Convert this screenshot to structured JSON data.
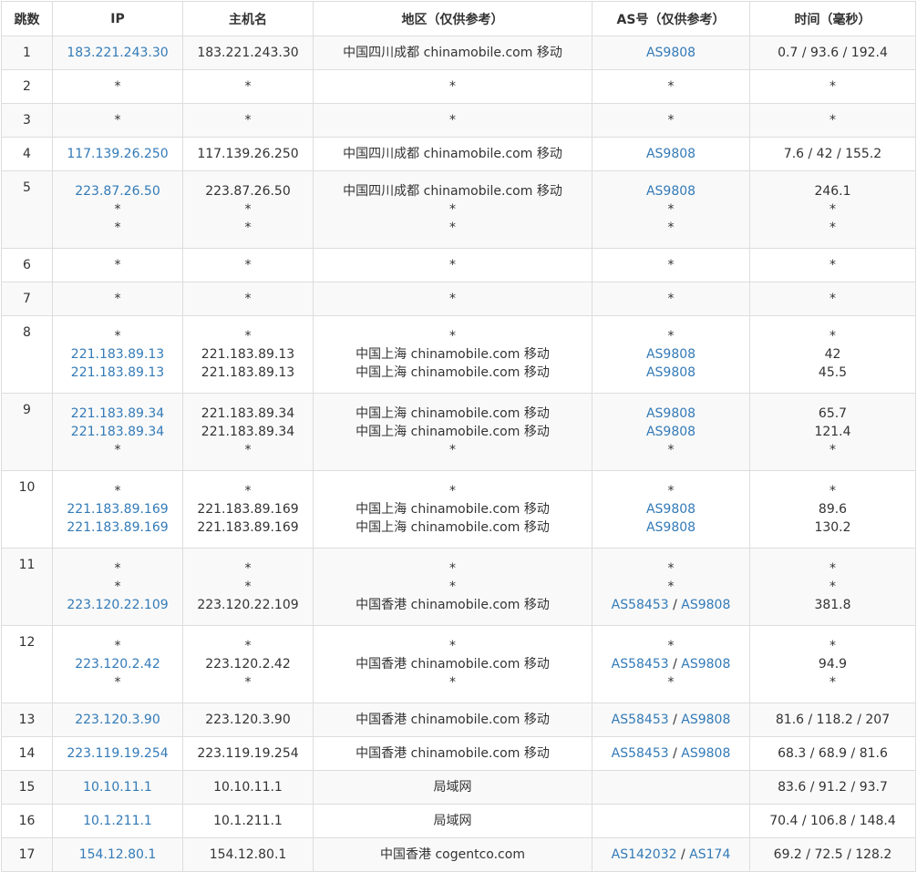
{
  "table": {
    "headers": [
      "跳数",
      "IP",
      "主机名",
      "地区（仅供参考）",
      "AS号（仅供参考）",
      "时间（毫秒）"
    ],
    "rows": [
      {
        "hop": "1",
        "lines": [
          {
            "ip": "183.221.243.30",
            "host": "183.221.243.30",
            "region": "中国四川成都 chinamobile.com 移动",
            "as": [
              "AS9808"
            ],
            "time": "0.7 / 93.6 / 192.4"
          }
        ]
      },
      {
        "hop": "2",
        "lines": [
          {
            "ip": "*",
            "host": "*",
            "region": "*",
            "as": [
              "*"
            ],
            "time": "*"
          }
        ]
      },
      {
        "hop": "3",
        "lines": [
          {
            "ip": "*",
            "host": "*",
            "region": "*",
            "as": [
              "*"
            ],
            "time": "*"
          }
        ]
      },
      {
        "hop": "4",
        "lines": [
          {
            "ip": "117.139.26.250",
            "host": "117.139.26.250",
            "region": "中国四川成都 chinamobile.com 移动",
            "as": [
              "AS9808"
            ],
            "time": "7.6 / 42 / 155.2"
          }
        ]
      },
      {
        "hop": "5",
        "lines": [
          {
            "ip": "223.87.26.50",
            "host": "223.87.26.50",
            "region": "中国四川成都 chinamobile.com 移动",
            "as": [
              "AS9808"
            ],
            "time": "246.1"
          },
          {
            "ip": "*",
            "host": "*",
            "region": "*",
            "as": [
              "*"
            ],
            "time": "*"
          },
          {
            "ip": "*",
            "host": "*",
            "region": "*",
            "as": [
              "*"
            ],
            "time": "*"
          }
        ]
      },
      {
        "hop": "6",
        "lines": [
          {
            "ip": "*",
            "host": "*",
            "region": "*",
            "as": [
              "*"
            ],
            "time": "*"
          }
        ]
      },
      {
        "hop": "7",
        "lines": [
          {
            "ip": "*",
            "host": "*",
            "region": "*",
            "as": [
              "*"
            ],
            "time": "*"
          }
        ]
      },
      {
        "hop": "8",
        "lines": [
          {
            "ip": "*",
            "host": "*",
            "region": "*",
            "as": [
              "*"
            ],
            "time": "*"
          },
          {
            "ip": "221.183.89.13",
            "host": "221.183.89.13",
            "region": "中国上海 chinamobile.com 移动",
            "as": [
              "AS9808"
            ],
            "time": "42"
          },
          {
            "ip": "221.183.89.13",
            "host": "221.183.89.13",
            "region": "中国上海 chinamobile.com 移动",
            "as": [
              "AS9808"
            ],
            "time": "45.5"
          }
        ]
      },
      {
        "hop": "9",
        "lines": [
          {
            "ip": "221.183.89.34",
            "host": "221.183.89.34",
            "region": "中国上海 chinamobile.com 移动",
            "as": [
              "AS9808"
            ],
            "time": "65.7"
          },
          {
            "ip": "221.183.89.34",
            "host": "221.183.89.34",
            "region": "中国上海 chinamobile.com 移动",
            "as": [
              "AS9808"
            ],
            "time": "121.4"
          },
          {
            "ip": "*",
            "host": "*",
            "region": "*",
            "as": [
              "*"
            ],
            "time": "*"
          }
        ]
      },
      {
        "hop": "10",
        "lines": [
          {
            "ip": "*",
            "host": "*",
            "region": "*",
            "as": [
              "*"
            ],
            "time": "*"
          },
          {
            "ip": "221.183.89.169",
            "host": "221.183.89.169",
            "region": "中国上海 chinamobile.com 移动",
            "as": [
              "AS9808"
            ],
            "time": "89.6"
          },
          {
            "ip": "221.183.89.169",
            "host": "221.183.89.169",
            "region": "中国上海 chinamobile.com 移动",
            "as": [
              "AS9808"
            ],
            "time": "130.2"
          }
        ]
      },
      {
        "hop": "11",
        "lines": [
          {
            "ip": "*",
            "host": "*",
            "region": "*",
            "as": [
              "*"
            ],
            "time": "*"
          },
          {
            "ip": "*",
            "host": "*",
            "region": "*",
            "as": [
              "*"
            ],
            "time": "*"
          },
          {
            "ip": "223.120.22.109",
            "host": "223.120.22.109",
            "region": "中国香港 chinamobile.com 移动",
            "as": [
              "AS58453",
              "AS9808"
            ],
            "time": "381.8"
          }
        ]
      },
      {
        "hop": "12",
        "lines": [
          {
            "ip": "*",
            "host": "*",
            "region": "*",
            "as": [
              "*"
            ],
            "time": "*"
          },
          {
            "ip": "223.120.2.42",
            "host": "223.120.2.42",
            "region": "中国香港 chinamobile.com 移动",
            "as": [
              "AS58453",
              "AS9808"
            ],
            "time": "94.9"
          },
          {
            "ip": "*",
            "host": "*",
            "region": "*",
            "as": [
              "*"
            ],
            "time": "*"
          }
        ]
      },
      {
        "hop": "13",
        "lines": [
          {
            "ip": "223.120.3.90",
            "host": "223.120.3.90",
            "region": "中国香港 chinamobile.com 移动",
            "as": [
              "AS58453",
              "AS9808"
            ],
            "time": "81.6 / 118.2 / 207"
          }
        ]
      },
      {
        "hop": "14",
        "lines": [
          {
            "ip": "223.119.19.254",
            "host": "223.119.19.254",
            "region": "中国香港 chinamobile.com 移动",
            "as": [
              "AS58453",
              "AS9808"
            ],
            "time": "68.3 / 68.9 / 81.6"
          }
        ]
      },
      {
        "hop": "15",
        "lines": [
          {
            "ip": "10.10.11.1",
            "host": "10.10.11.1",
            "region": "局域网",
            "as": [],
            "time": "83.6 / 91.2 / 93.7"
          }
        ]
      },
      {
        "hop": "16",
        "lines": [
          {
            "ip": "10.1.211.1",
            "host": "10.1.211.1",
            "region": "局域网",
            "as": [],
            "time": "70.4 / 106.8 / 148.4"
          }
        ]
      },
      {
        "hop": "17",
        "lines": [
          {
            "ip": "154.12.80.1",
            "host": "154.12.80.1",
            "region": "中国香港 cogentco.com",
            "as": [
              "AS142032",
              "AS174"
            ],
            "time": "69.2 / 72.5 / 128.2"
          }
        ]
      }
    ]
  },
  "colors": {
    "link": "#337ab7",
    "text": "#333333",
    "border": "#dddddd",
    "row_stripe": "#f9f9f9"
  },
  "as_separator": " / "
}
